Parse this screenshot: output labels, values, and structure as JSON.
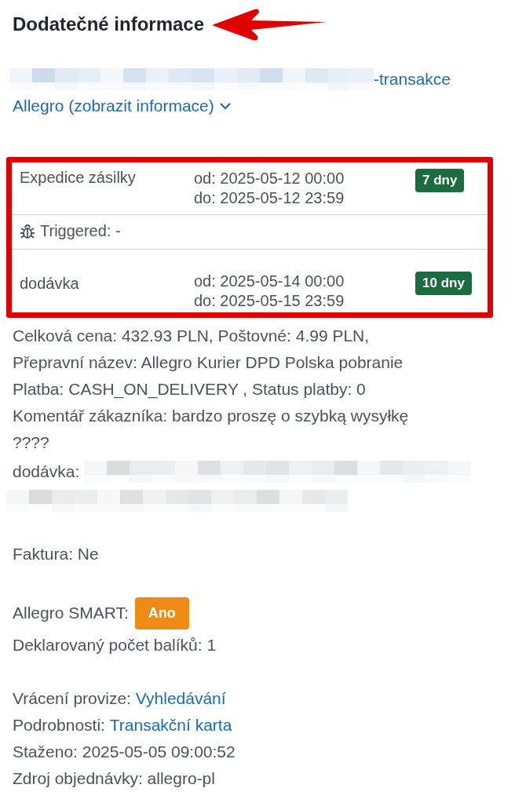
{
  "heading": "Dodatečné informace",
  "transaction_link": "-transakce",
  "allegro_toggle": {
    "label": "Allegro (zobrazit informace)",
    "expanded": false
  },
  "schedule": [
    {
      "kind": "window",
      "name": "Expedice zásilky",
      "from": "od: 2025-05-12 00:00",
      "to": "do: 2025-05-12 23:59",
      "badge": "7 dny"
    },
    {
      "kind": "trigger",
      "text": "Triggered: -"
    },
    {
      "kind": "window",
      "name": "dodávka",
      "from": "od: 2025-05-14 00:00",
      "to": "do: 2025-05-15 23:59",
      "badge": "10 dny"
    }
  ],
  "sections": [
    [
      {
        "kind": "text",
        "text": "Celková cena: 432.93 PLN, Poštovné: 4.99 PLN,"
      },
      {
        "kind": "text",
        "text": "Přepravní název: Allegro Kurier DPD Polska pobranie"
      },
      {
        "kind": "text",
        "text": "Platba: CASH_ON_DELIVERY , Status platby: 0"
      },
      {
        "kind": "text",
        "text": "Komentář zákazníka: bardzo proszę o szybką wysyłkę"
      },
      {
        "kind": "text",
        "text": "????"
      },
      {
        "kind": "redacted",
        "label": "dodávka:"
      }
    ],
    [
      {
        "kind": "text",
        "text": "Faktura: Ne"
      }
    ],
    [
      {
        "kind": "badge",
        "label": "Allegro SMART:",
        "badge": "Ano"
      },
      {
        "kind": "text",
        "text": "Deklarovaný počet balíků: 1"
      }
    ],
    [
      {
        "kind": "link",
        "label": "Vrácení provize:",
        "link": "Vyhledávání"
      },
      {
        "kind": "link",
        "label": "Podrobnosti:",
        "link": "Transakční karta"
      },
      {
        "kind": "text",
        "text": "Staženo: 2025-05-05 09:00:52"
      },
      {
        "kind": "text",
        "text": "Zdroj objednávky: allegro-pl"
      }
    ]
  ]
}
